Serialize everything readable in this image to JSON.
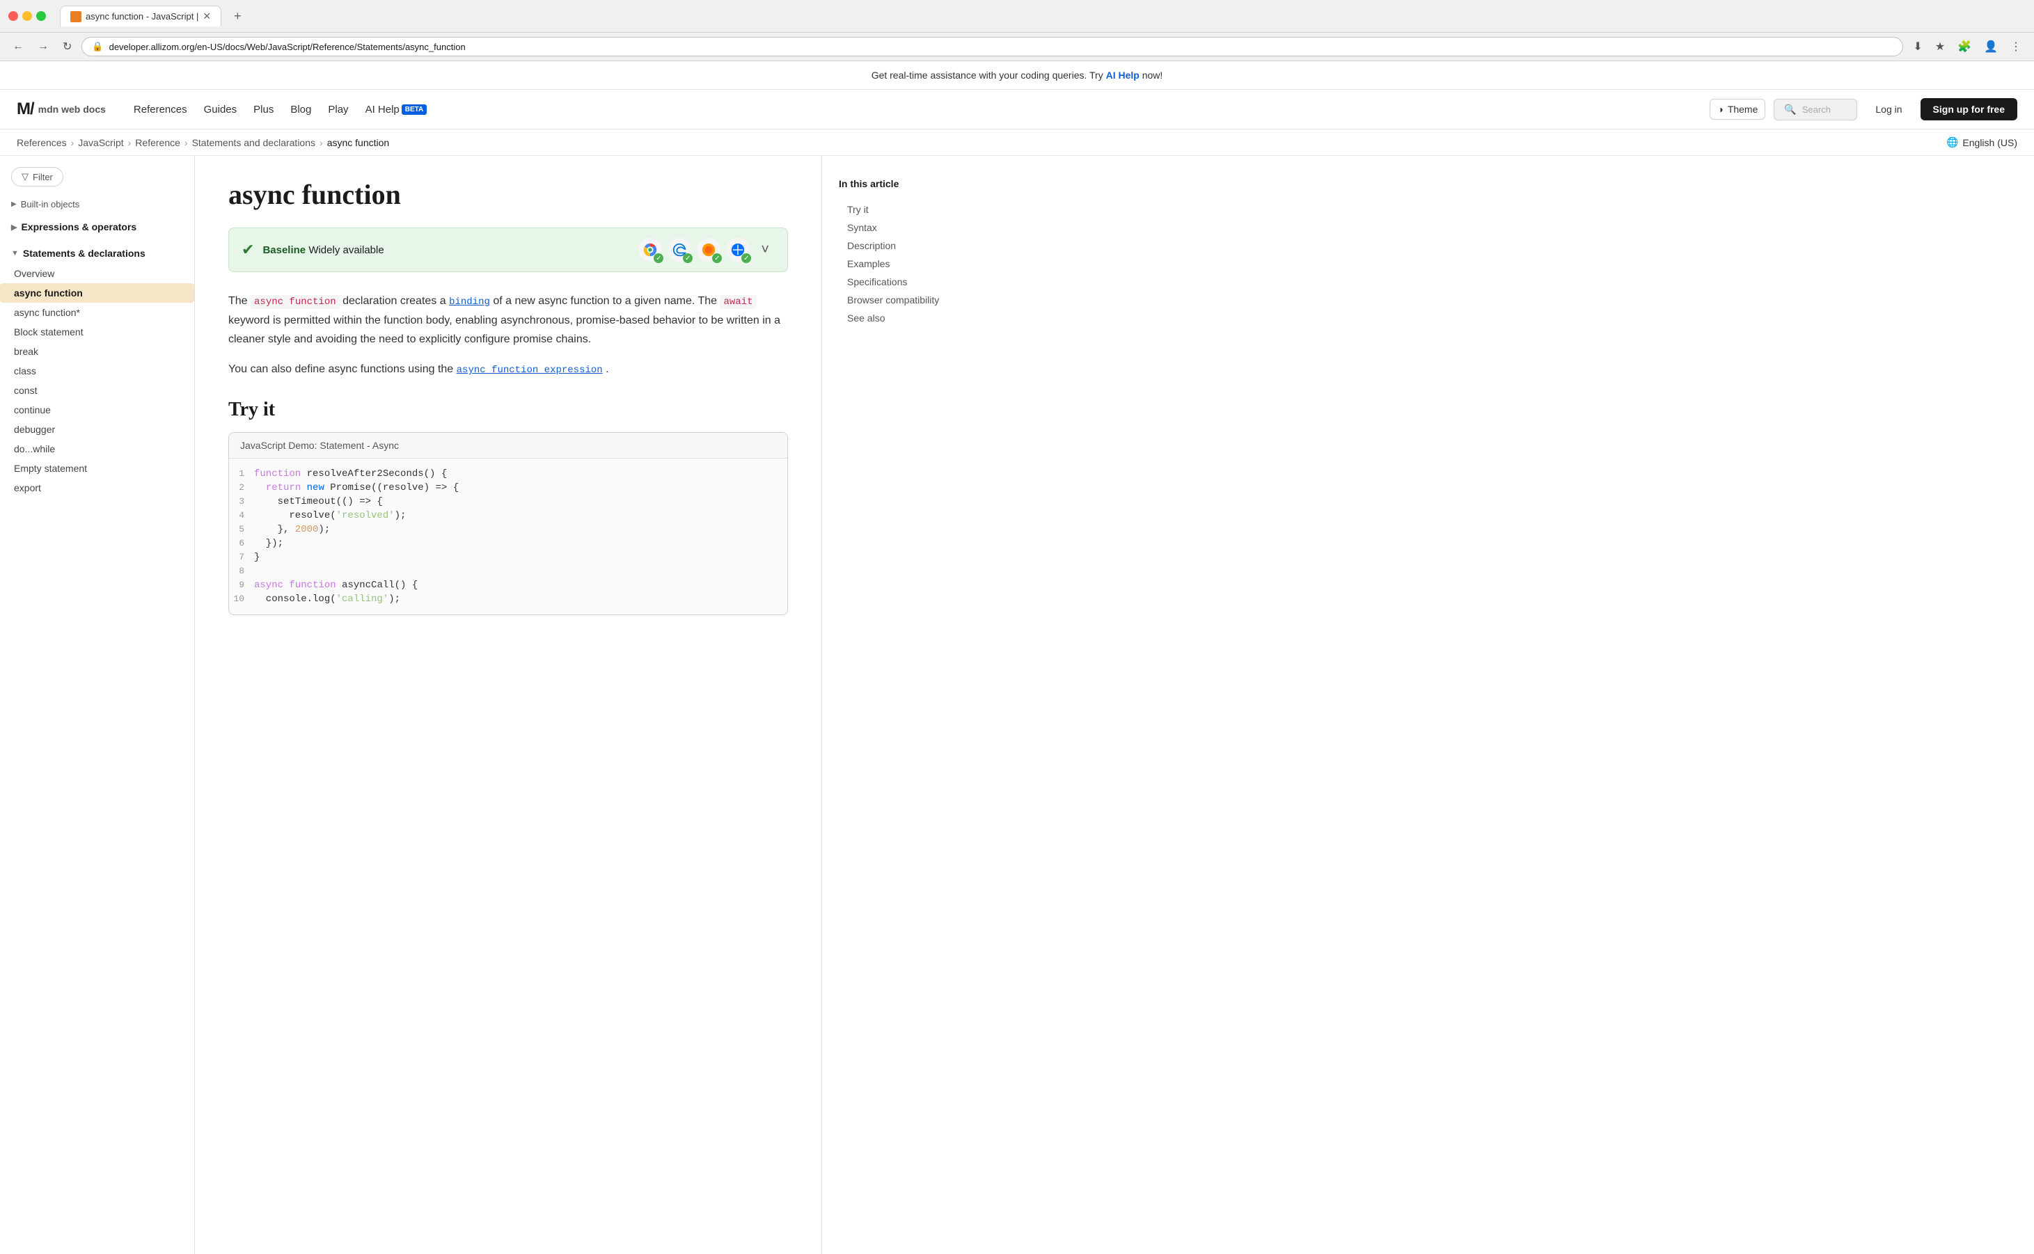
{
  "browser": {
    "tab_title": "async function - JavaScript |",
    "url": "developer.allizom.org/en-US/docs/Web/JavaScript/Reference/Statements/async_function",
    "new_tab_label": "+"
  },
  "banner": {
    "text": "Get real-time assistance with your coding queries. Try ",
    "link_text": "AI Help",
    "text_after": " now!"
  },
  "header": {
    "logo_m": "M/",
    "logo_text": "mdn web docs",
    "nav": {
      "references": "References",
      "guides": "Guides",
      "plus": "Plus",
      "blog": "Blog",
      "play": "Play",
      "aihelp": "AI Help"
    },
    "theme_label": "Theme",
    "search_placeholder": "Search",
    "login_label": "Log in",
    "signup_label": "Sign up for free"
  },
  "breadcrumb": {
    "items": [
      "References",
      "JavaScript",
      "Reference",
      "Statements and declarations",
      "async function"
    ],
    "lang": "English (US)"
  },
  "sidebar": {
    "filter_label": "Filter",
    "built_in_label": "Built-in objects",
    "expressions_label": "Expressions & operators",
    "statements_label": "Statements & declarations",
    "items": [
      {
        "label": "Overview",
        "active": false
      },
      {
        "label": "async function",
        "active": true
      },
      {
        "label": "async function*",
        "active": false
      },
      {
        "label": "Block statement",
        "active": false
      },
      {
        "label": "break",
        "active": false
      },
      {
        "label": "class",
        "active": false
      },
      {
        "label": "const",
        "active": false
      },
      {
        "label": "continue",
        "active": false
      },
      {
        "label": "debugger",
        "active": false
      },
      {
        "label": "do...while",
        "active": false
      },
      {
        "label": "Empty statement",
        "active": false
      },
      {
        "label": "export",
        "active": false
      }
    ]
  },
  "main": {
    "title": "async function",
    "baseline_label": "Baseline",
    "baseline_desc": "Widely available",
    "description_p1_before": "The ",
    "description_code1": "async function",
    "description_p1_mid": " declaration creates a ",
    "description_link": "binding",
    "description_p1_after": " of a new async function to a given name. The",
    "description_code2": "await",
    "description_p2": "keyword is permitted within the function body, enabling asynchronous, promise-based behavior to be written in a cleaner style and avoiding the need to explicitly configure promise chains.",
    "description_p3_before": "You can also define async functions using the ",
    "description_link2": "async function expression",
    "description_p3_after": ".",
    "try_it_title": "Try it",
    "code_demo_label": "JavaScript Demo: Statement - Async",
    "code_lines": [
      {
        "num": 1,
        "tokens": [
          {
            "t": "kw",
            "v": "function"
          },
          {
            "t": "pl",
            "v": " resolveAfter2Seconds() {"
          }
        ]
      },
      {
        "num": 2,
        "tokens": [
          {
            "t": "pl",
            "v": "  "
          },
          {
            "t": "kw",
            "v": "return"
          },
          {
            "t": "pl",
            "v": " "
          },
          {
            "t": "kw-blue",
            "v": "new"
          },
          {
            "t": "pl",
            "v": " Promise((resolve) => {"
          }
        ]
      },
      {
        "num": 3,
        "tokens": [
          {
            "t": "pl",
            "v": "    setTimeout(() => {"
          }
        ]
      },
      {
        "num": 4,
        "tokens": [
          {
            "t": "pl",
            "v": "      resolve("
          },
          {
            "t": "str",
            "v": "'resolved'"
          },
          {
            "t": "pl",
            "v": ");"
          }
        ]
      },
      {
        "num": 5,
        "tokens": [
          {
            "t": "pl",
            "v": "    }, "
          },
          {
            "t": "num",
            "v": "2000"
          },
          {
            "t": "pl",
            "v": ");"
          }
        ]
      },
      {
        "num": 6,
        "tokens": [
          {
            "t": "pl",
            "v": "  });"
          }
        ]
      },
      {
        "num": 7,
        "tokens": [
          {
            "t": "pl",
            "v": "}"
          }
        ]
      },
      {
        "num": 8,
        "tokens": [
          {
            "t": "pl",
            "v": ""
          }
        ]
      },
      {
        "num": 9,
        "tokens": [
          {
            "t": "kw",
            "v": "async"
          },
          {
            "t": "pl",
            "v": " "
          },
          {
            "t": "kw",
            "v": "function"
          },
          {
            "t": "pl",
            "v": " asyncCall() {"
          }
        ]
      },
      {
        "num": 10,
        "tokens": [
          {
            "t": "pl",
            "v": "  console.log("
          },
          {
            "t": "str",
            "v": "'calling'"
          },
          {
            "t": "pl",
            "v": ");"
          }
        ]
      }
    ]
  },
  "toc": {
    "title": "In this article",
    "items": [
      {
        "label": "Try it",
        "active": false
      },
      {
        "label": "Syntax",
        "active": false
      },
      {
        "label": "Description",
        "active": false
      },
      {
        "label": "Examples",
        "active": false
      },
      {
        "label": "Specifications",
        "active": false
      },
      {
        "label": "Browser compatibility",
        "active": false
      },
      {
        "label": "See also",
        "active": false
      }
    ]
  }
}
